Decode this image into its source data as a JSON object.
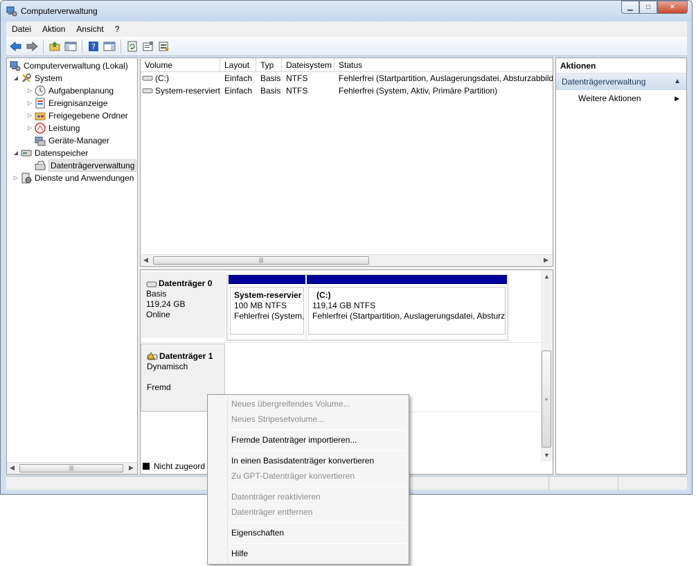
{
  "window": {
    "title": "Computerverwaltung",
    "controls": {
      "minimize": "▁",
      "maximize": "□",
      "close": "✕"
    }
  },
  "menubar": [
    "Datei",
    "Aktion",
    "Ansicht",
    "?"
  ],
  "toolbar": {
    "icons": [
      "back-arrow-icon",
      "forward-arrow-icon",
      "up-folder-icon",
      "show-hide-console-tree-icon",
      "help-icon",
      "show-hide-action-pane-icon",
      "refresh-icon",
      "properties-icon",
      "export-icon"
    ]
  },
  "tree": {
    "items": [
      {
        "label": "Computerverwaltung (Lokal)",
        "twisty": "",
        "icon": "computer-management-icon"
      },
      {
        "label": "System",
        "twisty": "◢",
        "icon": "tools-icon"
      },
      {
        "label": "Aufgabenplanung",
        "twisty": "▷",
        "icon": "clock-icon"
      },
      {
        "label": "Ereignisanzeige",
        "twisty": "▷",
        "icon": "event-viewer-icon"
      },
      {
        "label": "Freigegebene Ordner",
        "twisty": "▷",
        "icon": "shared-folder-icon"
      },
      {
        "label": "Leistung",
        "twisty": "▷",
        "icon": "performance-icon"
      },
      {
        "label": "Geräte-Manager",
        "twisty": "",
        "icon": "device-manager-icon"
      },
      {
        "label": "Datenspeicher",
        "twisty": "◢",
        "icon": "storage-icon"
      },
      {
        "label": "Datenträgerverwaltung",
        "twisty": "",
        "icon": "disk-management-icon"
      },
      {
        "label": "Dienste und Anwendungen",
        "twisty": "▷",
        "icon": "services-icon"
      }
    ]
  },
  "volumes": {
    "columns": [
      "Volume",
      "Layout",
      "Typ",
      "Dateisystem",
      "Status"
    ],
    "rows": [
      [
        "(C:)",
        "Einfach",
        "Basis",
        "NTFS",
        "Fehlerfrei (Startpartition, Auslagerungsdatei, Absturzabbild"
      ],
      [
        "System-reserviert",
        "Einfach",
        "Basis",
        "NTFS",
        "Fehlerfrei (System, Aktiv, Primäre Partition)"
      ]
    ]
  },
  "disks": [
    {
      "name": "Datenträger 0",
      "line1": "Basis",
      "line2": "119,24 GB",
      "line3": "Online"
    },
    {
      "name": "Datenträger 1",
      "line1": "Dynamisch",
      "line2": "",
      "line3": "Fremd"
    }
  ],
  "partitions": [
    {
      "name": "System-reservier",
      "size": "100 MB NTFS",
      "status": "Fehlerfrei (System,"
    },
    {
      "name": "(C:)",
      "size": "119,14 GB NTFS",
      "status": "Fehlerfrei (Startpartition, Auslagerungsdatei, Absturz"
    }
  ],
  "legend": {
    "unallocated": "Nicht zugeord"
  },
  "actions": {
    "title": "Aktionen",
    "group": "Datenträgerverwaltung",
    "more": "Weitere Aktionen"
  },
  "context_menu": {
    "items": [
      {
        "label": "Neues übergreifendes Volume...",
        "enabled": false
      },
      {
        "label": "Neues Stripesetvolume...",
        "enabled": false
      },
      {
        "label": "Fremde Datenträger importieren...",
        "enabled": true
      },
      {
        "label": "In einen Basisdatenträger konvertieren",
        "enabled": true
      },
      {
        "label": "Zu GPT-Datenträger konvertieren",
        "enabled": false
      },
      {
        "label": "Datenträger reaktivieren",
        "enabled": false
      },
      {
        "label": "Datenträger entfernen",
        "enabled": false
      },
      {
        "label": "Eigenschaften",
        "enabled": true
      },
      {
        "label": "Hilfe",
        "enabled": true
      }
    ]
  },
  "colors": {
    "partition_bar": "#00009c",
    "action_group": "#cfdcec"
  }
}
